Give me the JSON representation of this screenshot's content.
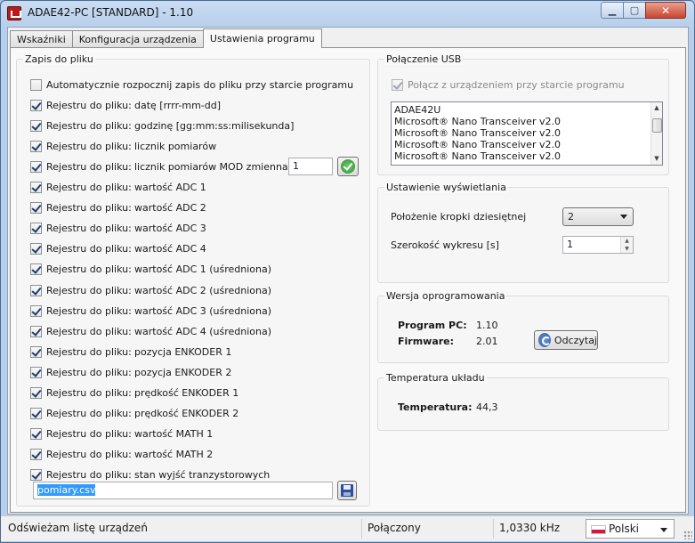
{
  "window": {
    "title": "ADAE42-PC [STANDARD] - 1.10"
  },
  "tabs": [
    {
      "label": "Wskaźniki"
    },
    {
      "label": "Konfiguracja urządzenia"
    },
    {
      "label": "Ustawienia programu"
    }
  ],
  "log_group": {
    "title": "Zapis do pliku",
    "autostart_label": "Automatycznie rozpocznij zapis do pliku przy starcie programu",
    "autostart_checked": false,
    "prefix": "Rejestru do pliku:",
    "items": [
      {
        "label": "datę [rrrr-mm-dd]",
        "checked": true
      },
      {
        "label": "godzinę [gg:mm:ss:milisekunda]",
        "checked": true
      },
      {
        "label": "licznik pomiarów",
        "checked": true
      },
      {
        "label": "licznik pomiarów MOD zmienna:",
        "checked": true
      },
      {
        "label": "wartość ADC 1",
        "checked": true
      },
      {
        "label": "wartość ADC 2",
        "checked": true
      },
      {
        "label": "wartość ADC 3",
        "checked": true
      },
      {
        "label": "wartość ADC 4",
        "checked": true
      },
      {
        "label": "wartość ADC 1 (uśredniona)",
        "checked": true
      },
      {
        "label": "wartość ADC 2 (uśredniona)",
        "checked": true
      },
      {
        "label": "wartość ADC 3 (uśredniona)",
        "checked": true
      },
      {
        "label": "wartość ADC 4 (uśredniona)",
        "checked": true
      },
      {
        "label": "pozycja ENKODER 1",
        "checked": true
      },
      {
        "label": "pozycja ENKODER 2",
        "checked": true
      },
      {
        "label": "prędkość ENKODER 1",
        "checked": true
      },
      {
        "label": "prędkość ENKODER 2",
        "checked": true
      },
      {
        "label": "wartość MATH 1",
        "checked": true
      },
      {
        "label": "wartość MATH 2",
        "checked": true
      },
      {
        "label": "stan wyjść tranzystorowych",
        "checked": true
      }
    ],
    "mod_value": "1",
    "filename": "pomiary.csv"
  },
  "usb_group": {
    "title": "Połączenie USB",
    "autoconnect_label": "Połącz z urządzeniem przy starcie programu",
    "autoconnect_checked": true,
    "devices": [
      "ADAE42U",
      "Microsoft® Nano Transceiver v2.0",
      "Microsoft® Nano Transceiver v2.0",
      "Microsoft® Nano Transceiver v2.0",
      "Microsoft® Nano Transceiver v2.0"
    ]
  },
  "display_group": {
    "title": "Ustawienie wyświetlania",
    "decimal_label": "Położenie kropki dziesiętnej",
    "decimal_value": "2",
    "width_label": "Szerokość wykresu [s]",
    "width_value": "1"
  },
  "firmware_group": {
    "title": "Wersja oprogramowania",
    "pc_label": "Program PC:",
    "pc_value": "1.10",
    "fw_label": "Firmware:",
    "fw_value": "2.01",
    "read_button": "Odczytaj"
  },
  "temp_group": {
    "title": "Temperatura układu",
    "temp_label": "Temperatura:",
    "temp_value": "44,3"
  },
  "status": {
    "message": "Odświeżam listę urządzeń",
    "connection": "Połączony",
    "frequency": "1,0330 kHz",
    "language": "Polski"
  }
}
